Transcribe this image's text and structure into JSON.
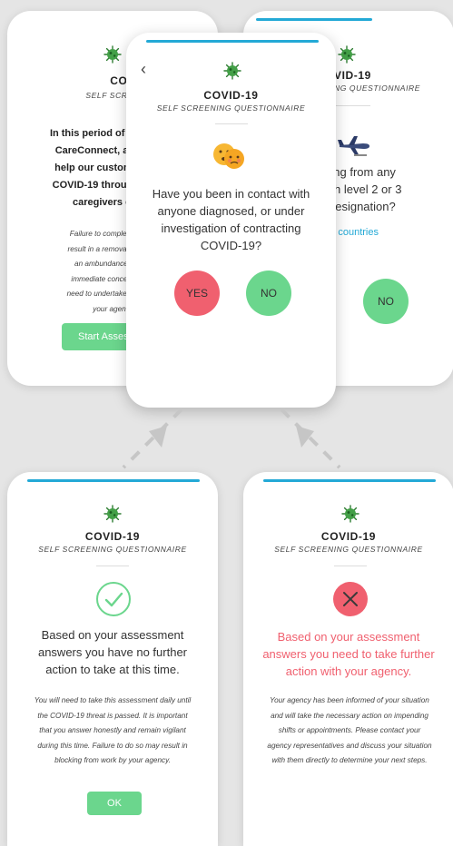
{
  "covid_title": "COVID-19",
  "subtitle": "SELF SCREENING QUESTIONNAIRE",
  "left_card": {
    "title": "COVID-",
    "subtitle": "SELF SCREENING QU",
    "para1": [
      "In this period of unprecide",
      "CareConnect, are taking",
      "help our customers com",
      "COVID-19 through daily s",
      "caregivers on ou"
    ],
    "para2": [
      "Failure to complete the daily",
      "result in a removal from shifts",
      "an ambundance of cautio",
      "immediate concerns regard",
      "need to undertake this assess",
      "your agency d"
    ],
    "start_button": "Start Asses"
  },
  "right_card": {
    "title": "VID-19",
    "subtitle": "ING QUESTIONNAIRE",
    "question": [
      "turning from any",
      "s with level 2 or 3",
      "designation?"
    ],
    "link": "ted countries",
    "no_button": "NO"
  },
  "center_card": {
    "question": [
      "Have you been in contact with",
      "anyone diagnosed, or under",
      "investigation of contracting",
      "COVID-19?"
    ],
    "yes_button": "YES",
    "no_button": "NO"
  },
  "success_card": {
    "message": [
      "Based on your assessment",
      "answers you have no further",
      "action to take at this time."
    ],
    "details": [
      "You will need to take this assessment daily until",
      "the COVID-19 threat is passed. It is important",
      "that you answer honestly and remain vigilant",
      "during this time. Failure to do so may result in",
      "blocking from work by your agency."
    ],
    "ok_button": "OK"
  },
  "fail_card": {
    "message": [
      "Based on your assessment",
      "answers you need to take further",
      "action with your agency."
    ],
    "details": [
      "Your agency has been informed of your situation",
      "and will take the necessary action on impending",
      "shifts or appointments. Please contact your",
      "agency representatives and discuss your situation",
      "with them directly to determine your next steps."
    ]
  },
  "colors": {
    "accent": "#23a9d6",
    "green": "#6bd68d",
    "red": "#f0606f",
    "background": "#e5e5e5"
  },
  "icons": [
    "virus-icon",
    "back-chevron-icon",
    "emoji-face-icon",
    "airplane-icon",
    "checkmark-icon",
    "cross-icon"
  ]
}
